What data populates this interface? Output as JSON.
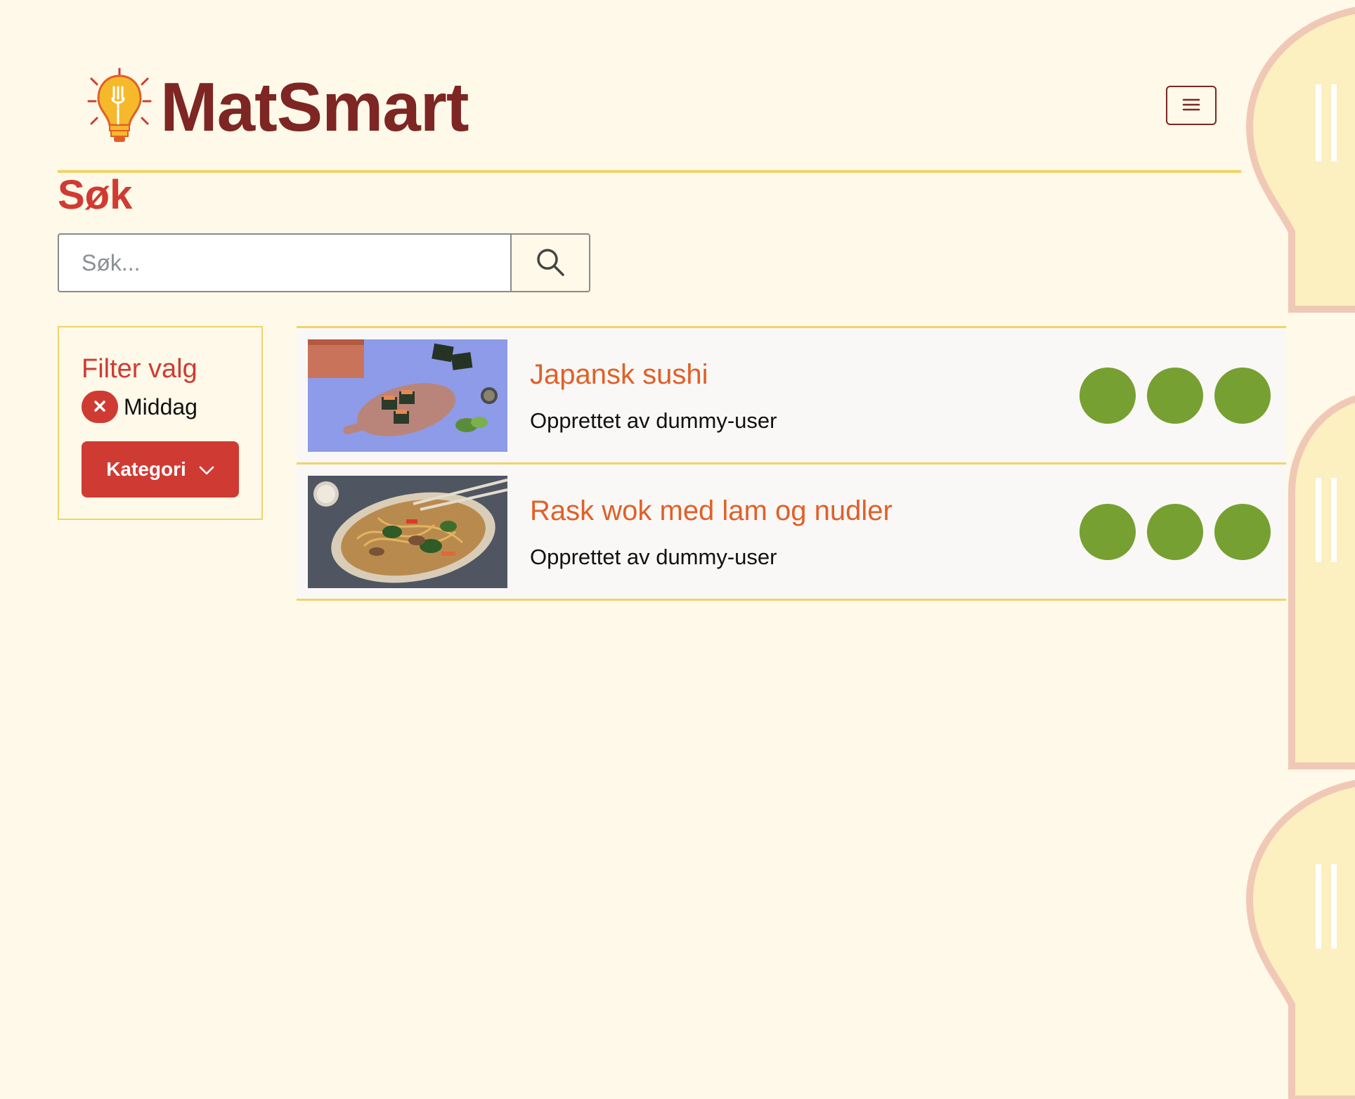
{
  "brand": {
    "name": "MatSmart"
  },
  "search": {
    "title": "Søk",
    "placeholder": "Søk..."
  },
  "filter": {
    "title": "Filter valg",
    "chips": [
      {
        "label": "Middag"
      }
    ],
    "dropdown_label": "Kategori"
  },
  "results": [
    {
      "title": "Japansk sushi",
      "subtitle": "Opprettet av dummy-user",
      "rating_dots": 3
    },
    {
      "title": "Rask wok med lam og nudler",
      "subtitle": "Opprettet av dummy-user",
      "rating_dots": 3
    }
  ],
  "colors": {
    "background": "#fef9e8",
    "brand": "#7d2623",
    "accent_red": "#cf3b33",
    "title_orange": "#e06028",
    "divider_yellow": "#f1d36b",
    "dot_green": "#76a031"
  },
  "icons": {
    "logo": "lightbulb-fork-icon",
    "menu": "hamburger-icon",
    "search": "search-icon",
    "chip_remove": "close-icon",
    "dropdown": "chevron-down-icon"
  }
}
